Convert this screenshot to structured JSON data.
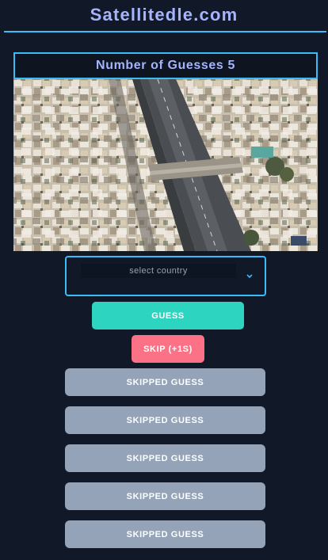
{
  "header": {
    "title": "Satellitedle.com"
  },
  "game": {
    "guesses_label": "Number of Guesses 5",
    "select_placeholder": "select country",
    "guess_button": "GUESS",
    "skip_button": "SKIP (+1S)",
    "skipped_label": "SKIPPED GUESS"
  },
  "skipped_guesses": [
    "SKIPPED GUESS",
    "SKIPPED GUESS",
    "SKIPPED GUESS",
    "SKIPPED GUESS",
    "SKIPPED GUESS"
  ],
  "icons": {
    "select_chevron": "chevron-down-icon"
  },
  "colors": {
    "background": "#111827",
    "accent": "#38bdf8",
    "title": "#a5b4fc",
    "guess": "#2dd4bf",
    "skip": "#fb7185",
    "skipped": "#94a3b8"
  }
}
